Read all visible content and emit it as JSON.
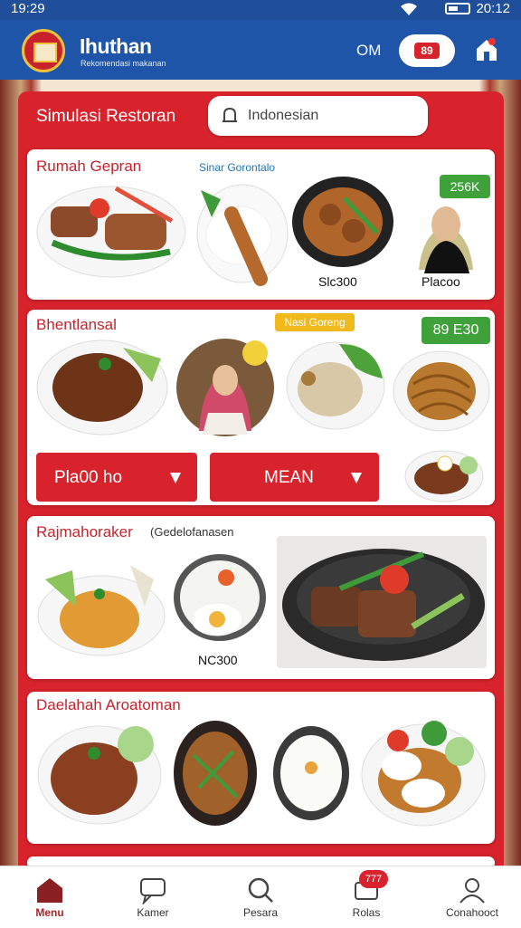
{
  "status_bar": {
    "time": "19:29",
    "clock": "20:12"
  },
  "header": {
    "app_title": "Ihuthan",
    "app_subtitle": "Rekomendasi makanan",
    "account_text": "OM",
    "badge_text": "89",
    "icons": [
      "logo-emblem",
      "home-icon"
    ]
  },
  "panel": {
    "title": "Simulasi Restoran",
    "search_placeholder": "Indonesian"
  },
  "sections": [
    {
      "title": "Rumah Gepran",
      "subtitle": "Sinar Gorontalo",
      "badge": "256K",
      "dishes": [
        {
          "name": "grilled-fish-plate"
        },
        {
          "name": "rice-with-fried-fish"
        },
        {
          "name": "beef-stew-bowl",
          "price": "Slc300"
        },
        {
          "name": "chef-portrait",
          "price": "Placoo"
        }
      ]
    },
    {
      "title": "Bhentlansal",
      "subtitle": "Nasi Goreng",
      "badge": "89 E30",
      "dishes": [
        {
          "name": "rendang-plate"
        },
        {
          "name": "chef-circle-photo"
        },
        {
          "name": "chicken-vegetable-plate"
        },
        {
          "name": "fried-noodles-plate"
        },
        {
          "name": "side-dish-plate"
        }
      ],
      "buttons": [
        {
          "label": "Pla00 ho",
          "icon": "arrow-icon"
        },
        {
          "label": "MEAN",
          "icon": "arrow-icon"
        }
      ]
    },
    {
      "title": "Rajmahoraker",
      "subtitle": "(Gedelofanasen",
      "dishes": [
        {
          "name": "nasi-tumpeng-plate"
        },
        {
          "name": "rice-egg-plate",
          "price": "NC300"
        },
        {
          "name": "grilled-beef-pan"
        }
      ]
    },
    {
      "title": "Daelahah Aroatoman",
      "dishes": [
        {
          "name": "bean-stew-plate"
        },
        {
          "name": "sauteed-vegetables-plate"
        },
        {
          "name": "white-rice-plate"
        },
        {
          "name": "rice-cake-curry-plate"
        }
      ]
    }
  ],
  "tab_bar": {
    "notification_count": "777",
    "tabs": [
      {
        "label": "Menu",
        "icon": "home-icon",
        "active": true
      },
      {
        "label": "Kamer",
        "icon": "chat-icon",
        "active": false
      },
      {
        "label": "Pesara",
        "icon": "search-icon",
        "active": false
      },
      {
        "label": "Rolas",
        "icon": "message-icon",
        "active": false
      },
      {
        "label": "Conahooct",
        "icon": "user-icon",
        "active": false
      }
    ]
  },
  "colors": {
    "brand_blue": "#1f55a8",
    "brand_red": "#d8232c",
    "badge_green": "#3ea13a",
    "badge_yellow": "#f2b91c"
  }
}
